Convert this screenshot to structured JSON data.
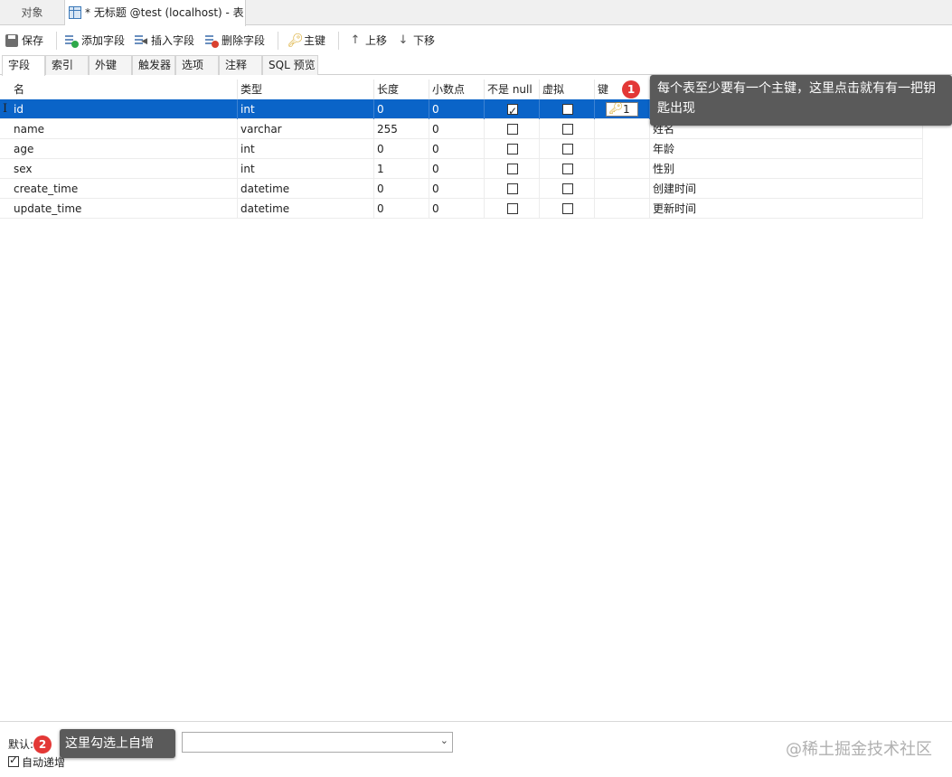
{
  "doc_tabs": {
    "objects": "对象",
    "active": "* 无标题 @test (localhost) - 表"
  },
  "toolbar": {
    "save": "保存",
    "add_field": "添加字段",
    "insert_field": "插入字段",
    "delete_field": "删除字段",
    "primary_key": "主键",
    "move_up": "上移",
    "move_down": "下移"
  },
  "sub_tabs": [
    "字段",
    "索引",
    "外键",
    "触发器",
    "选项",
    "注释",
    "SQL 预览"
  ],
  "grid": {
    "headers": {
      "name": "名",
      "type": "类型",
      "length": "长度",
      "decimals": "小数点",
      "not_null": "不是 null",
      "virtual": "虚拟",
      "key": "键",
      "comment": ""
    },
    "rows": [
      {
        "name": "id",
        "type": "int",
        "length": "0",
        "decimals": "0",
        "not_null": true,
        "virtual": false,
        "key": "1",
        "comment": ""
      },
      {
        "name": "name",
        "type": "varchar",
        "length": "255",
        "decimals": "0",
        "not_null": false,
        "virtual": false,
        "key": "",
        "comment": "姓名"
      },
      {
        "name": "age",
        "type": "int",
        "length": "0",
        "decimals": "0",
        "not_null": false,
        "virtual": false,
        "key": "",
        "comment": "年龄"
      },
      {
        "name": "sex",
        "type": "int",
        "length": "1",
        "decimals": "0",
        "not_null": false,
        "virtual": false,
        "key": "",
        "comment": "性别"
      },
      {
        "name": "create_time",
        "type": "datetime",
        "length": "0",
        "decimals": "0",
        "not_null": false,
        "virtual": false,
        "key": "",
        "comment": "创建时间"
      },
      {
        "name": "update_time",
        "type": "datetime",
        "length": "0",
        "decimals": "0",
        "not_null": false,
        "virtual": false,
        "key": "",
        "comment": "更新时间"
      }
    ]
  },
  "annotations": {
    "badge1": "1",
    "tip1": "每个表至少要有一个主键，这里点击就有有一把钥匙出现",
    "badge2": "2",
    "tip2": "这里勾选上自增"
  },
  "bottom": {
    "default_label": "默认:",
    "default_value": "",
    "auto_increment_label": "自动递增",
    "auto_increment_checked": true
  },
  "watermark": "@稀土掘金技术社区",
  "colors": {
    "selection": "#0a64c8",
    "badge": "#e33836",
    "tooltip": "#5a5a5a",
    "key_icon": "#d6a21a"
  }
}
